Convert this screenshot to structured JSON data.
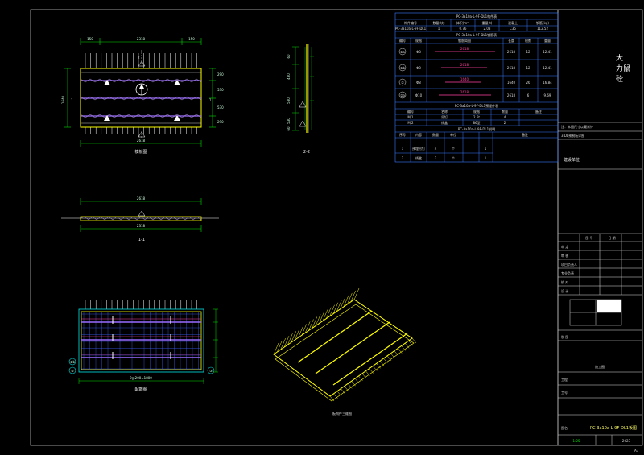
{
  "drawing": {
    "title_block": {
      "company_chars": [
        "大",
        "力",
        "鼠",
        "砼"
      ],
      "note_row": "注：本图尺寸以毫米计",
      "project_label": "建设单位",
      "row_labels_left": [
        "审 定",
        "审 核",
        "项目负责人",
        "专业负责",
        "校 对",
        "设 计",
        "制 图"
      ],
      "row_labels_right": [
        "工程",
        "工号"
      ],
      "drawing_name_label": "图名",
      "drawing_no": "PC-3a10a-L-9F-DL1板图",
      "scale": "1:25",
      "date": "2023",
      "stage": "施工图",
      "sheet": "A3",
      "small_note": "3 DL预制板详图",
      "header_cells": [
        "图 号",
        "日 期"
      ],
      "corner_mark": "A3"
    },
    "tables": {
      "main_title": "PC-3a10a-L-9F-DL1构件表",
      "main_headers": [
        "构件编号",
        "数量(块)",
        "体积(m³)",
        "重量(t)",
        "混凝土",
        "钢筋(kg)"
      ],
      "main_row": [
        "PC-3a10a-L-9F-DL1",
        "1",
        "0.76",
        "2.08",
        "C35",
        "112.52"
      ],
      "rebar_title": "PC-3a10a-L-9F-DL1钢筋表",
      "rebar_headers": [
        "编号",
        "规格",
        "钢筋简图",
        "长度",
        "根数",
        "重量"
      ],
      "rebar_rows": [
        {
          "id": "①a",
          "spec": "Φ8",
          "len": "2618",
          "count": "12",
          "weight": "12.41"
        },
        {
          "id": "①b",
          "spec": "Φ8",
          "len": "2618",
          "count": "12",
          "weight": "12.41"
        },
        {
          "id": "②",
          "spec": "Φ8",
          "len": "1640",
          "count": "26",
          "weight": "16.84"
        },
        {
          "id": "②a",
          "spec": "Φ10",
          "len": "2618",
          "count": "6",
          "weight": "9.69"
        }
      ],
      "embed_title": "PC-3a10a-L-9F-DL1预埋件表",
      "embed_headers": [
        "编号",
        "名称",
        "规格",
        "数量",
        "备注"
      ],
      "embed_rows": [
        [
          "MJ1",
          "吊钉",
          "2.5t",
          "4",
          ""
        ],
        [
          "MJ2",
          "线盒",
          "86型",
          "2",
          ""
        ]
      ],
      "note_title": "PC-3a10a-L-9F-DL1说明",
      "note_headers": [
        "序号",
        "内容",
        "数量",
        "单位",
        "备注"
      ],
      "note_rows": [
        [
          "1",
          "预埋吊钉",
          "4",
          "个",
          "1"
        ],
        [
          "2",
          "线盒",
          "2",
          "个",
          "1"
        ]
      ],
      "note_text": "1.本板采用C35混凝土，钢筋保护层厚度15mm；2.未注明尺寸详见结构施工图。"
    },
    "views": {
      "plan_label": "模板图",
      "plan_dims": {
        "top": [
          "150",
          "2318",
          "150"
        ],
        "bottom": "2618",
        "left": "1640",
        "right": [
          "290",
          "530",
          "530",
          "290"
        ]
      },
      "section22_label": "2-2",
      "section22_dims": [
        "60",
        "430",
        "530",
        "530",
        "60"
      ],
      "section11_label": "1-1",
      "section11_dims": [
        "2618",
        "2318"
      ],
      "rebar_plan_label": "配筋图",
      "rebar_plan_bottom": "9@200=1800",
      "iso_label": "板构件三维图",
      "rebar_bubbles": [
        "①b",
        "②",
        "③"
      ]
    }
  },
  "colors": {
    "frame": "#ffffff",
    "dimension": "#00e000",
    "outline_yellow": "#ffff00",
    "rebar_purple": "#9a6cff",
    "cyan": "#00e5e5",
    "table_line": "#3a7bff",
    "magenta": "#ff3fa0",
    "grid_blue": "#4060ff"
  }
}
